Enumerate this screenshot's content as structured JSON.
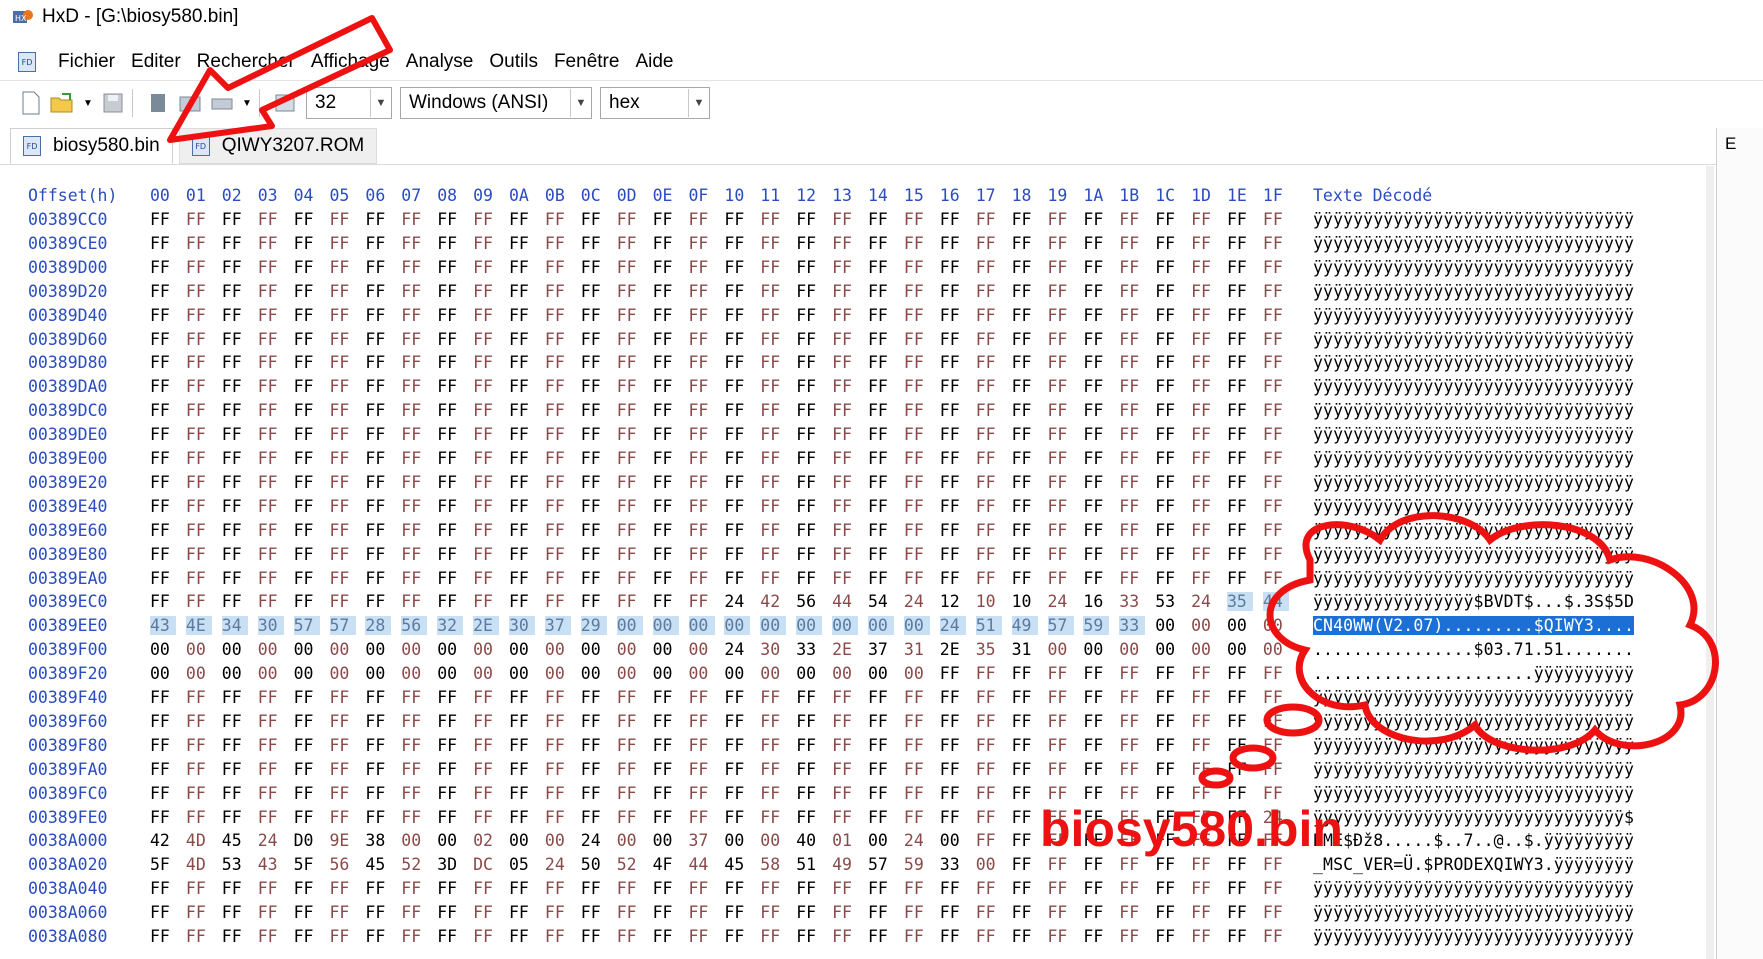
{
  "window": {
    "title": "HxD - [G:\\biosy580.bin]"
  },
  "menu": [
    "Fichier",
    "Editer",
    "Rechercher",
    "Affichage",
    "Analyse",
    "Outils",
    "Fenêtre",
    "Aide"
  ],
  "toolbar": {
    "bytes_per_row": "32",
    "charset": "Windows (ANSI)",
    "offset_base": "hex"
  },
  "tabs": [
    {
      "label": "biosy580.bin",
      "active": true
    },
    {
      "label": "QIWY3207.ROM",
      "active": false
    }
  ],
  "side_panel": {
    "label": "E"
  },
  "hex_view": {
    "offset_header": "Offset(h)",
    "column_headers": [
      "00",
      "01",
      "02",
      "03",
      "04",
      "05",
      "06",
      "07",
      "08",
      "09",
      "0A",
      "0B",
      "0C",
      "0D",
      "0E",
      "0F",
      "10",
      "11",
      "12",
      "13",
      "14",
      "15",
      "16",
      "17",
      "18",
      "19",
      "1A",
      "1B",
      "1C",
      "1D",
      "1E",
      "1F"
    ],
    "text_header": "Texte Décodé",
    "rows": [
      {
        "offset": "00389CC0",
        "bytes": "FF FF FF FF FF FF FF FF FF FF FF FF FF FF FF FF FF FF FF FF FF FF FF FF FF FF FF FF FF FF FF FF",
        "text": "ÿÿÿÿÿÿÿÿÿÿÿÿÿÿÿÿÿÿÿÿÿÿÿÿÿÿÿÿÿÿÿÿ"
      },
      {
        "offset": "00389CE0",
        "bytes": "FF FF FF FF FF FF FF FF FF FF FF FF FF FF FF FF FF FF FF FF FF FF FF FF FF FF FF FF FF FF FF FF",
        "text": "ÿÿÿÿÿÿÿÿÿÿÿÿÿÿÿÿÿÿÿÿÿÿÿÿÿÿÿÿÿÿÿÿ"
      },
      {
        "offset": "00389D00",
        "bytes": "FF FF FF FF FF FF FF FF FF FF FF FF FF FF FF FF FF FF FF FF FF FF FF FF FF FF FF FF FF FF FF FF",
        "text": "ÿÿÿÿÿÿÿÿÿÿÿÿÿÿÿÿÿÿÿÿÿÿÿÿÿÿÿÿÿÿÿÿ"
      },
      {
        "offset": "00389D20",
        "bytes": "FF FF FF FF FF FF FF FF FF FF FF FF FF FF FF FF FF FF FF FF FF FF FF FF FF FF FF FF FF FF FF FF",
        "text": "ÿÿÿÿÿÿÿÿÿÿÿÿÿÿÿÿÿÿÿÿÿÿÿÿÿÿÿÿÿÿÿÿ"
      },
      {
        "offset": "00389D40",
        "bytes": "FF FF FF FF FF FF FF FF FF FF FF FF FF FF FF FF FF FF FF FF FF FF FF FF FF FF FF FF FF FF FF FF",
        "text": "ÿÿÿÿÿÿÿÿÿÿÿÿÿÿÿÿÿÿÿÿÿÿÿÿÿÿÿÿÿÿÿÿ"
      },
      {
        "offset": "00389D60",
        "bytes": "FF FF FF FF FF FF FF FF FF FF FF FF FF FF FF FF FF FF FF FF FF FF FF FF FF FF FF FF FF FF FF FF",
        "text": "ÿÿÿÿÿÿÿÿÿÿÿÿÿÿÿÿÿÿÿÿÿÿÿÿÿÿÿÿÿÿÿÿ"
      },
      {
        "offset": "00389D80",
        "bytes": "FF FF FF FF FF FF FF FF FF FF FF FF FF FF FF FF FF FF FF FF FF FF FF FF FF FF FF FF FF FF FF FF",
        "text": "ÿÿÿÿÿÿÿÿÿÿÿÿÿÿÿÿÿÿÿÿÿÿÿÿÿÿÿÿÿÿÿÿ"
      },
      {
        "offset": "00389DA0",
        "bytes": "FF FF FF FF FF FF FF FF FF FF FF FF FF FF FF FF FF FF FF FF FF FF FF FF FF FF FF FF FF FF FF FF",
        "text": "ÿÿÿÿÿÿÿÿÿÿÿÿÿÿÿÿÿÿÿÿÿÿÿÿÿÿÿÿÿÿÿÿ"
      },
      {
        "offset": "00389DC0",
        "bytes": "FF FF FF FF FF FF FF FF FF FF FF FF FF FF FF FF FF FF FF FF FF FF FF FF FF FF FF FF FF FF FF FF",
        "text": "ÿÿÿÿÿÿÿÿÿÿÿÿÿÿÿÿÿÿÿÿÿÿÿÿÿÿÿÿÿÿÿÿ"
      },
      {
        "offset": "00389DE0",
        "bytes": "FF FF FF FF FF FF FF FF FF FF FF FF FF FF FF FF FF FF FF FF FF FF FF FF FF FF FF FF FF FF FF FF",
        "text": "ÿÿÿÿÿÿÿÿÿÿÿÿÿÿÿÿÿÿÿÿÿÿÿÿÿÿÿÿÿÿÿÿ"
      },
      {
        "offset": "00389E00",
        "bytes": "FF FF FF FF FF FF FF FF FF FF FF FF FF FF FF FF FF FF FF FF FF FF FF FF FF FF FF FF FF FF FF FF",
        "text": "ÿÿÿÿÿÿÿÿÿÿÿÿÿÿÿÿÿÿÿÿÿÿÿÿÿÿÿÿÿÿÿÿ"
      },
      {
        "offset": "00389E20",
        "bytes": "FF FF FF FF FF FF FF FF FF FF FF FF FF FF FF FF FF FF FF FF FF FF FF FF FF FF FF FF FF FF FF FF",
        "text": "ÿÿÿÿÿÿÿÿÿÿÿÿÿÿÿÿÿÿÿÿÿÿÿÿÿÿÿÿÿÿÿÿ"
      },
      {
        "offset": "00389E40",
        "bytes": "FF FF FF FF FF FF FF FF FF FF FF FF FF FF FF FF FF FF FF FF FF FF FF FF FF FF FF FF FF FF FF FF",
        "text": "ÿÿÿÿÿÿÿÿÿÿÿÿÿÿÿÿÿÿÿÿÿÿÿÿÿÿÿÿÿÿÿÿ"
      },
      {
        "offset": "00389E60",
        "bytes": "FF FF FF FF FF FF FF FF FF FF FF FF FF FF FF FF FF FF FF FF FF FF FF FF FF FF FF FF FF FF FF FF",
        "text": "ÿÿÿÿÿÿÿÿÿÿÿÿÿÿÿÿÿÿÿÿÿÿÿÿÿÿÿÿÿÿÿÿ"
      },
      {
        "offset": "00389E80",
        "bytes": "FF FF FF FF FF FF FF FF FF FF FF FF FF FF FF FF FF FF FF FF FF FF FF FF FF FF FF FF FF FF FF FF",
        "text": "ÿÿÿÿÿÿÿÿÿÿÿÿÿÿÿÿÿÿÿÿÿÿÿÿÿÿÿÿÿÿÿÿ"
      },
      {
        "offset": "00389EA0",
        "bytes": "FF FF FF FF FF FF FF FF FF FF FF FF FF FF FF FF FF FF FF FF FF FF FF FF FF FF FF FF FF FF FF FF",
        "text": "ÿÿÿÿÿÿÿÿÿÿÿÿÿÿÿÿÿÿÿÿÿÿÿÿÿÿÿÿÿÿÿÿ"
      },
      {
        "offset": "00389EC0",
        "bytes": "FF FF FF FF FF FF FF FF FF FF FF FF FF FF FF FF 24 42 56 44 54 24 12 10 10 24 16 33 53 24 35 44",
        "text": "ÿÿÿÿÿÿÿÿÿÿÿÿÿÿÿÿ$BVDT$...$.3S$5D"
      },
      {
        "offset": "00389EE0",
        "bytes": "43 4E 34 30 57 57 28 56 32 2E 30 37 29 00 00 00 00 00 00 00 00 00 24 51 49 57 59 33 00 00 00 00",
        "text": "CN40WW(V2.07).........$QIWY3...."
      },
      {
        "offset": "00389F00",
        "bytes": "00 00 00 00 00 00 00 00 00 00 00 00 00 00 00 00 24 30 33 2E 37 31 2E 35 31 00 00 00 00 00 00 00",
        "text": "................$03.71.51......."
      },
      {
        "offset": "00389F20",
        "bytes": "00 00 00 00 00 00 00 00 00 00 00 00 00 00 00 00 00 00 00 00 00 00 FF FF FF FF FF FF FF FF FF FF",
        "text": "......................ÿÿÿÿÿÿÿÿÿÿ"
      },
      {
        "offset": "00389F40",
        "bytes": "FF FF FF FF FF FF FF FF FF FF FF FF FF FF FF FF FF FF FF FF FF FF FF FF FF FF FF FF FF FF FF FF",
        "text": "ÿÿÿÿÿÿÿÿÿÿÿÿÿÿÿÿÿÿÿÿÿÿÿÿÿÿÿÿÿÿÿÿ"
      },
      {
        "offset": "00389F60",
        "bytes": "FF FF FF FF FF FF FF FF FF FF FF FF FF FF FF FF FF FF FF FF FF FF FF FF FF FF FF FF FF FF FF FF",
        "text": "ÿÿÿÿÿÿÿÿÿÿÿÿÿÿÿÿÿÿÿÿÿÿÿÿÿÿÿÿÿÿÿÿ"
      },
      {
        "offset": "00389F80",
        "bytes": "FF FF FF FF FF FF FF FF FF FF FF FF FF FF FF FF FF FF FF FF FF FF FF FF FF FF FF FF FF FF FF FF",
        "text": "ÿÿÿÿÿÿÿÿÿÿÿÿÿÿÿÿÿÿÿÿÿÿÿÿÿÿÿÿÿÿÿÿ"
      },
      {
        "offset": "00389FA0",
        "bytes": "FF FF FF FF FF FF FF FF FF FF FF FF FF FF FF FF FF FF FF FF FF FF FF FF FF FF FF FF FF FF FF FF",
        "text": "ÿÿÿÿÿÿÿÿÿÿÿÿÿÿÿÿÿÿÿÿÿÿÿÿÿÿÿÿÿÿÿÿ"
      },
      {
        "offset": "00389FC0",
        "bytes": "FF FF FF FF FF FF FF FF FF FF FF FF FF FF FF FF FF FF FF FF FF FF FF FF FF FF FF FF FF FF FF FF",
        "text": "ÿÿÿÿÿÿÿÿÿÿÿÿÿÿÿÿÿÿÿÿÿÿÿÿÿÿÿÿÿÿÿÿ"
      },
      {
        "offset": "00389FE0",
        "bytes": "FF FF FF FF FF FF FF FF FF FF FF FF FF FF FF FF FF FF FF FF FF FF FF FF FF FF FF FF FF FF FF 24",
        "text": "ÿÿÿÿÿÿÿÿÿÿÿÿÿÿÿÿÿÿÿÿÿÿÿÿÿÿÿÿÿÿÿ$"
      },
      {
        "offset": "0038A000",
        "bytes": "42 4D 45 24 D0 9E 38 00 00 02 00 00 24 00 00 37 00 00 40 01 00 24 00 FF FF FF FF FF FF FF FF FF",
        "text": "BME$Ðž8.....$..7..@..$.ÿÿÿÿÿÿÿÿÿ"
      },
      {
        "offset": "0038A020",
        "bytes": "5F 4D 53 43 5F 56 45 52 3D DC 05 24 50 52 4F 44 45 58 51 49 57 59 33 00 FF FF FF FF FF FF FF FF",
        "text": "_MSC_VER=Ü.$PRODEXQIWY3.ÿÿÿÿÿÿÿÿ"
      },
      {
        "offset": "0038A040",
        "bytes": "FF FF FF FF FF FF FF FF FF FF FF FF FF FF FF FF FF FF FF FF FF FF FF FF FF FF FF FF FF FF FF FF",
        "text": "ÿÿÿÿÿÿÿÿÿÿÿÿÿÿÿÿÿÿÿÿÿÿÿÿÿÿÿÿÿÿÿÿ"
      },
      {
        "offset": "0038A060",
        "bytes": "FF FF FF FF FF FF FF FF FF FF FF FF FF FF FF FF FF FF FF FF FF FF FF FF FF FF FF FF FF FF FF FF",
        "text": "ÿÿÿÿÿÿÿÿÿÿÿÿÿÿÿÿÿÿÿÿÿÿÿÿÿÿÿÿÿÿÿÿ"
      },
      {
        "offset": "0038A080",
        "bytes": "FF FF FF FF FF FF FF FF FF FF FF FF FF FF FF FF FF FF FF FF FF FF FF FF FF FF FF FF FF FF FF FF",
        "text": "ÿÿÿÿÿÿÿÿÿÿÿÿÿÿÿÿÿÿÿÿÿÿÿÿÿÿÿÿÿÿÿÿ"
      }
    ]
  },
  "annotation": {
    "label": "biosy580.bin",
    "color": "#ee1111"
  },
  "colors": {
    "offset_blue": "#2b4cc1",
    "selection": "#c9e0f4",
    "cursor": "#1c6fd4"
  }
}
